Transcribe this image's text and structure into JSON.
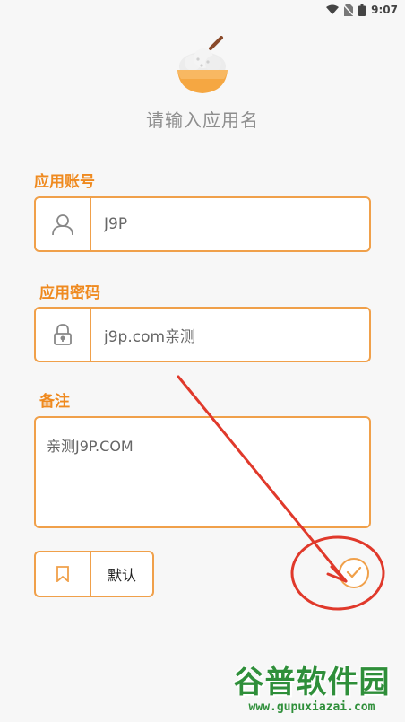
{
  "status_bar": {
    "time": "9:07",
    "icons": [
      "wifi-icon",
      "no-sim-icon",
      "battery-icon"
    ]
  },
  "header": {
    "logo_icon": "rice-bowl-icon",
    "app_name_placeholder": "请输入应用名"
  },
  "account": {
    "label": "应用账号",
    "value": "J9P",
    "icon": "user-icon"
  },
  "password": {
    "label": "应用密码",
    "value": "j9p.com亲测",
    "icon": "lock-icon"
  },
  "notes": {
    "label": "备注",
    "value": "亲测J9P.COM"
  },
  "default_button": {
    "label": "默认",
    "icon": "bookmark-icon"
  },
  "confirm": {
    "icon": "check-circle-icon"
  },
  "watermark": {
    "title": "谷普软件园",
    "url": "www.gupuxiazai.com"
  },
  "colors": {
    "accent": "#f0a04a",
    "label": "#ef8a1f",
    "annotation": "#e0392b",
    "watermark": "#2f8f3a",
    "background": "#f7f7f7"
  }
}
